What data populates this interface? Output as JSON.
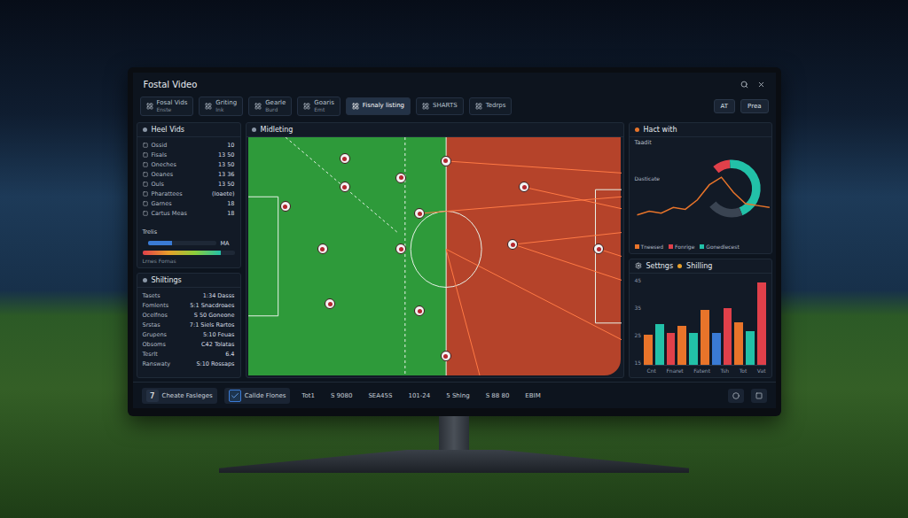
{
  "window": {
    "title": "Fostal Video"
  },
  "toolbar": {
    "items": [
      {
        "label": "Fosal Vids",
        "sub": "Enste",
        "selected": false
      },
      {
        "label": "Griting",
        "sub": "Ink",
        "selected": false
      },
      {
        "label": "Gearle",
        "sub": "Burd",
        "selected": false
      },
      {
        "label": "Goaris",
        "sub": "Emt",
        "selected": false
      },
      {
        "label": "Fisnaly listing",
        "selected": true
      },
      {
        "label": "SHARTS",
        "selected": false
      },
      {
        "label": "Tedrps",
        "selected": false
      }
    ],
    "right": [
      "AT",
      "Prea"
    ]
  },
  "heel_panel": {
    "title": "Heel Vids",
    "rows": [
      {
        "label": "Ossid",
        "value": "10"
      },
      {
        "label": "Fisals",
        "value": "13 50"
      },
      {
        "label": "Oneches",
        "value": "13 50"
      },
      {
        "label": "Oeanes",
        "value": "13 36"
      },
      {
        "label": "Ouls",
        "value": "13 50"
      },
      {
        "label": "Pharattees",
        "value": "(Ioaete)"
      },
      {
        "label": "Garnes",
        "value": "18"
      },
      {
        "label": "Cartus Meas",
        "value": "18"
      }
    ],
    "trend": {
      "label": "Trelis",
      "bar_label": "MA",
      "level": 0.35,
      "heat_label": "Lrnes Fornas",
      "heat_level": 0.85
    }
  },
  "shift_panel": {
    "title": "Shiltings",
    "rows": [
      {
        "label": "Tasets",
        "value": "1:34 Dasss"
      },
      {
        "label": "Fomlents",
        "value": "5:1 Snacdroaes"
      },
      {
        "label": "Ocelfnos",
        "value": "S 50 Goneone"
      },
      {
        "label": "Srstas",
        "value": "7:1 Siels Rartos"
      },
      {
        "label": "Grupens",
        "value": "5:10 Feuas"
      },
      {
        "label": "Obsoms",
        "value": "C42 Tolatas"
      },
      {
        "label": "Tesrlt",
        "value": "6.4"
      },
      {
        "label": "Ranswaty",
        "value": "S:10 Rossaps"
      }
    ]
  },
  "pitch_panel": {
    "title": "Midleting"
  },
  "gauge_panel": {
    "title": "Hact with",
    "labels": [
      "Taadit",
      "Dasticate"
    ],
    "gauge": [
      {
        "share": 0.1,
        "color": "#e0404a"
      },
      {
        "share": 0.45,
        "color": "#22c1a8"
      },
      {
        "share": 0.2,
        "color": "#3a4452"
      }
    ],
    "line": [
      10,
      12,
      11,
      14,
      13,
      18,
      26,
      30,
      22,
      16,
      15,
      14
    ],
    "legend": [
      {
        "label": "Tneesed",
        "color": "#e8742a"
      },
      {
        "label": "Fonrige",
        "color": "#e0404a"
      },
      {
        "label": "Gonedlecest",
        "color": "#22c1a8"
      }
    ]
  },
  "bar_panel": {
    "titles": [
      "Settngs",
      "Shilling"
    ],
    "ticks": [
      "45",
      "35",
      "25",
      "15"
    ],
    "max": 50,
    "x_labels": [
      "Cnt",
      "Fnaret",
      "Fatent",
      "Tsh",
      "Tot",
      "Vat"
    ],
    "bars": [
      {
        "value": 17,
        "color": "#e8742a"
      },
      {
        "value": 23,
        "color": "#22c1a8"
      },
      {
        "value": 18,
        "color": "#e0404a"
      },
      {
        "value": 22,
        "color": "#e8742a"
      },
      {
        "value": 18,
        "color": "#22c1a8"
      },
      {
        "value": 31,
        "color": "#e8742a"
      },
      {
        "value": 18,
        "color": "#3a7bd5"
      },
      {
        "value": 32,
        "color": "#e0404a"
      },
      {
        "value": 24,
        "color": "#e8742a"
      },
      {
        "value": 19,
        "color": "#22c1a8"
      },
      {
        "value": 47,
        "color": "#e0404a"
      }
    ]
  },
  "status_bar": {
    "items": [
      {
        "label": "Cheate Fasleges",
        "kind": "badge",
        "badge": "7",
        "checked": false
      },
      {
        "label": "Callde Flones",
        "kind": "check",
        "checked": true
      },
      {
        "label": "Tot1",
        "kind": "text",
        "checked": false
      },
      {
        "label": "S 9080",
        "kind": "text",
        "checked": false
      },
      {
        "label": "SEA45S",
        "kind": "text",
        "checked": false
      },
      {
        "label": "101-24",
        "kind": "text",
        "checked": false
      },
      {
        "label": "5 Shlng",
        "kind": "text",
        "checked": false
      },
      {
        "label": "S 88 80",
        "kind": "text",
        "checked": false
      },
      {
        "label": "EBIM",
        "kind": "text",
        "checked": false
      }
    ]
  }
}
